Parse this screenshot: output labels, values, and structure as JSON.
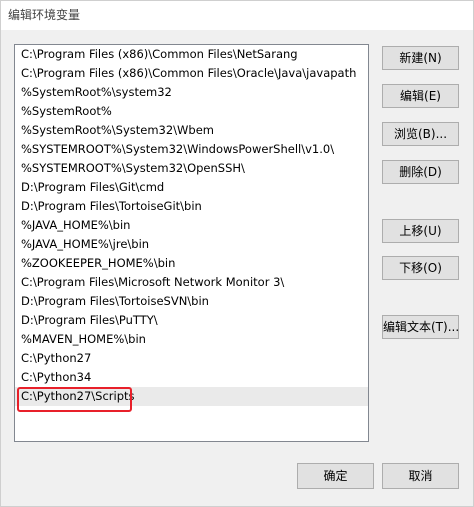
{
  "window": {
    "title": "编辑环境变量"
  },
  "paths": [
    "C:\\Program Files (x86)\\Common Files\\NetSarang",
    "C:\\Program Files (x86)\\Common Files\\Oracle\\Java\\javapath",
    "%SystemRoot%\\system32",
    "%SystemRoot%",
    "%SystemRoot%\\System32\\Wbem",
    "%SYSTEMROOT%\\System32\\WindowsPowerShell\\v1.0\\",
    "%SYSTEMROOT%\\System32\\OpenSSH\\",
    "D:\\Program Files\\Git\\cmd",
    "D:\\Program Files\\TortoiseGit\\bin",
    "%JAVA_HOME%\\bin",
    "%JAVA_HOME%\\jre\\bin",
    "%ZOOKEEPER_HOME%\\bin",
    "C:\\Program Files\\Microsoft Network Monitor 3\\",
    "D:\\Program Files\\TortoiseSVN\\bin",
    "D:\\Program Files\\PuTTY\\",
    "%MAVEN_HOME%\\bin",
    "C:\\Python27",
    "C:\\Python34",
    "C:\\Python27\\Scripts"
  ],
  "selected_index": 18,
  "buttons": {
    "new": "新建(N)",
    "edit": "编辑(E)",
    "browse": "浏览(B)...",
    "delete": "删除(D)",
    "move_up": "上移(U)",
    "move_down": "下移(O)",
    "edit_text": "编辑文本(T)...",
    "ok": "确定",
    "cancel": "取消"
  },
  "colors": {
    "highlight_border": "#e8202a",
    "selected_row": "#eaeaea"
  }
}
